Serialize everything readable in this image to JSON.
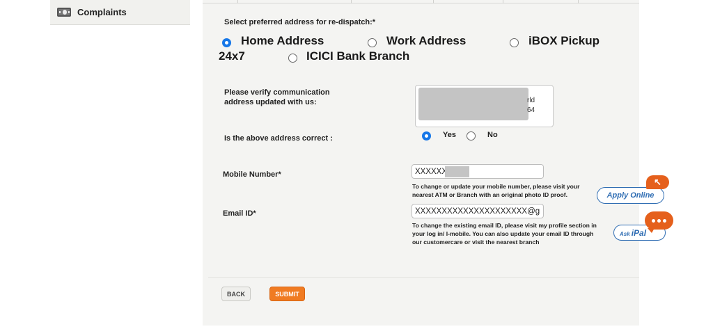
{
  "sidebar": {
    "items": [
      {
        "label": "Complaints",
        "icon": "money-icon"
      }
    ]
  },
  "form": {
    "dispatch_label": "Select preferred address for re-dispatch:*",
    "dispatch_options": [
      {
        "label": "Home Address",
        "selected": true
      },
      {
        "label": "Work Address",
        "selected": false
      },
      {
        "label": "iBOX Pickup",
        "selected": false
      },
      {
        "label": "ICICI Bank Branch",
        "selected": false
      }
    ],
    "ibox_suffix": "24x7",
    "verify_label": "Please verify communication address updated with us:",
    "address_lines": [
      "rld",
      "64"
    ],
    "correct_label": "Is the above address correct :",
    "correct_options": [
      {
        "label": "Yes",
        "selected": true
      },
      {
        "label": "No",
        "selected": false
      }
    ],
    "mobile_label": "Mobile Number*",
    "mobile_value": "XXXXXX",
    "mobile_hint": "To change or update your mobile number, please visit your nearest ATM or Branch with an original photo ID proof.",
    "email_label": "Email ID*",
    "email_value": "XXXXXXXXXXXXXXXXXXXXX@gma",
    "email_hint": "To change the existing email ID, please visit my profile section in your log in/ I-mobile. You can also update your email ID through our customercare or visit the nearest branch"
  },
  "buttons": {
    "back": "BACK",
    "submit": "SUBMIT"
  },
  "widgets": {
    "apply_online": "Apply Online",
    "ask_prefix": "Ask",
    "ask_name": "iPal"
  },
  "colors": {
    "accent_blue": "#1677e8",
    "submit_orange": "#f07b22",
    "widget_blue": "#2f6db3"
  }
}
